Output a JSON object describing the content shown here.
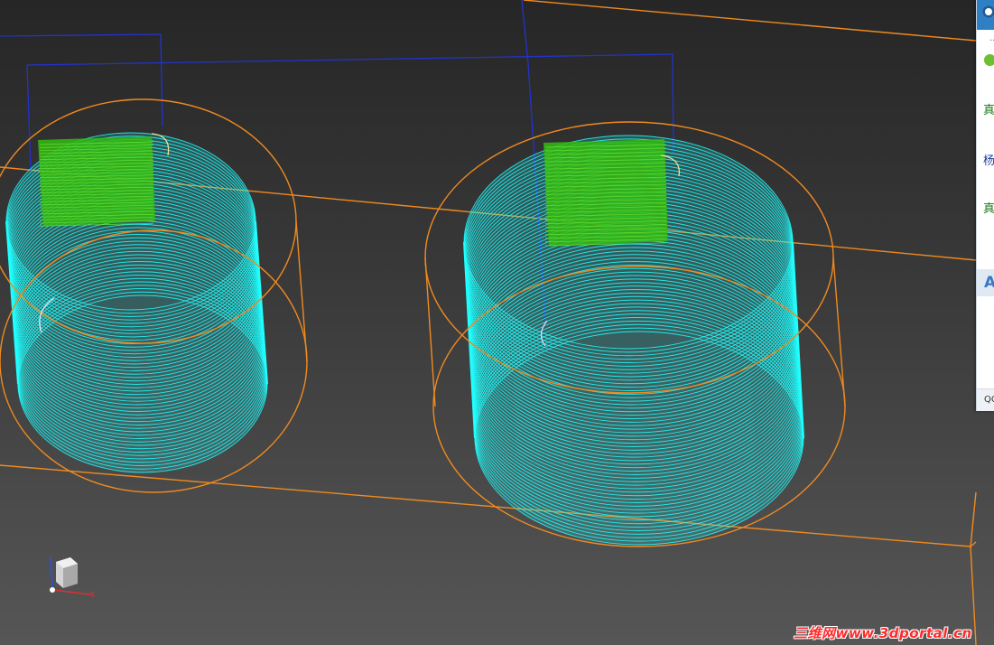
{
  "viewport": {
    "background_top": "#262626",
    "background_bottom": "#565656",
    "toolpath_color": "#21ffff",
    "highlight_color": "#33bb11",
    "boundary_color": "#f08a1f",
    "rapid_color": "#2233cc"
  },
  "gizmo": {
    "icon": "view-cube-icon",
    "axis_x": "X",
    "axis_colors": {
      "x": "#e03030",
      "z": "#3050e0"
    }
  },
  "side_panel": {
    "icon_logo": "app-logo-icon",
    "dots": "..",
    "icon_check": "check-icon",
    "items": [
      {
        "text": "真",
        "color": "#1b7a1b"
      },
      {
        "text": "杨",
        "color": "#1f3f9a"
      },
      {
        "text": "真",
        "color": "#1b7a1b"
      }
    ],
    "letter": "A",
    "footer": "QQ"
  },
  "watermark": {
    "text": "三维网www.3dportal.cn"
  }
}
